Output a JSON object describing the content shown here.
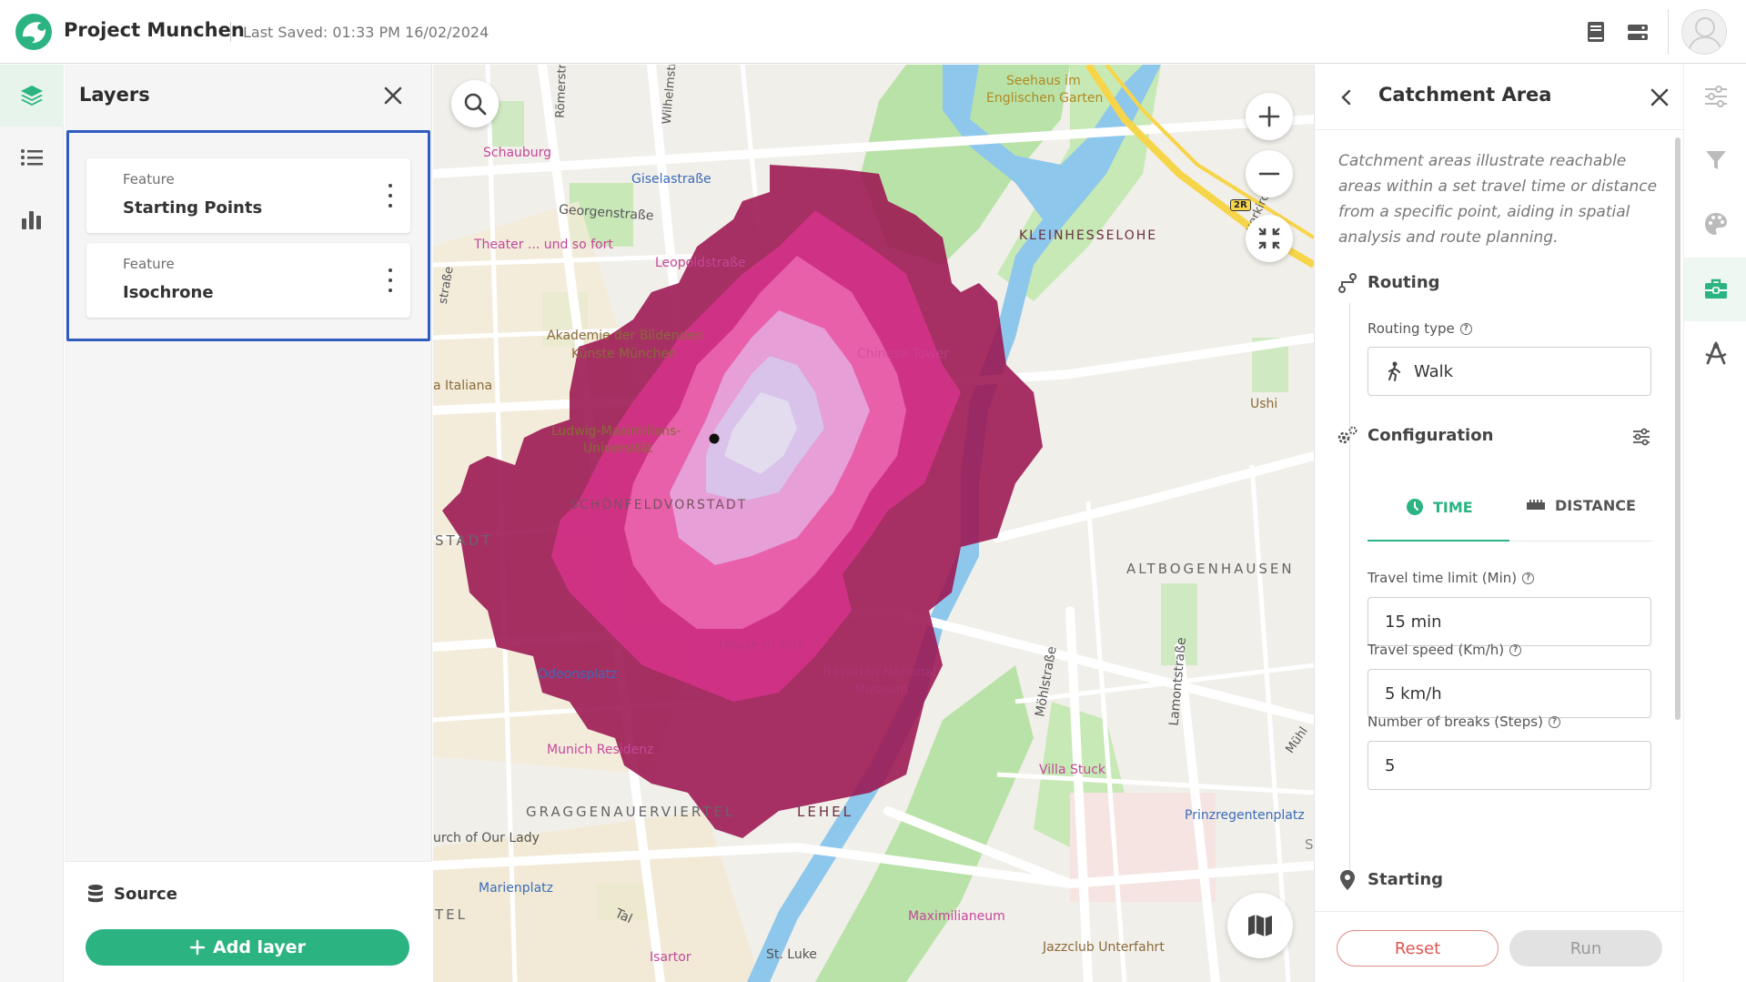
{
  "header": {
    "project_title": "Project Munchen",
    "last_saved": "Last Saved: 01:33 PM 16/02/2024"
  },
  "layers_panel": {
    "title": "Layers",
    "layers": [
      {
        "type_label": "Feature",
        "name": "Starting Points"
      },
      {
        "type_label": "Feature",
        "name": "Isochrone"
      }
    ],
    "source_label": "Source",
    "add_layer_label": "Add layer"
  },
  "map": {
    "labels": {
      "schauburg": "Schauburg",
      "giselastrasse": "Giselastraße",
      "georgenstrasse": "Georgenstraße",
      "leopoldstrasse": "Leopoldstraße",
      "theater": "Theater ... und so fort",
      "akademie1": "Akademie der Bildenden",
      "akademie2": "Künste München",
      "italiana": "a Italiana",
      "ludwig1": "Ludwig-Maximilians-",
      "ludwig2": "Universität",
      "schoenfeld": "SCHÖNFELDVORSTADT",
      "stadt": "STADT",
      "odeonsplatz": "Odeonsplatz",
      "residenz": "Munich Residenz",
      "graggenau": "GRAGGENAUERVIERTEL",
      "lehel": "LEHEL",
      "ourlady": "urch of Our Lady",
      "marienplatz": "Marienplatz",
      "tel": "TEL",
      "tal": "Tal",
      "isartor": "Isartor",
      "stluke": "St. Luke",
      "maximilianeum": "Maximilianeum",
      "jazzclub": "Jazzclub Unterfahrt",
      "villastuck": "Villa Stuck",
      "prinzregentenplatz": "Prinzregentenplatz",
      "altbogenhausen": "ALTBOGENHAUSEN",
      "ushi": "Ushi",
      "kleinhesselohe": "KLEINHESSELOHE",
      "seehaus1": "Seehaus im",
      "seehaus2": "Englischen Garten",
      "muehlstrasse": "Möhlstraße",
      "lamontstrasse": "Lamontstraße",
      "chinese_tower": "Chinese Tower",
      "house_of_arts": "House of Arts",
      "national1": "Bavarian National",
      "national2": "Museum",
      "roemer": "Römerstr.",
      "wilhelm": "Wilhelmstr.",
      "strasse_left": "straße",
      "road_badge": "2R",
      "uerkirch": "uerkirch.",
      "muehl": "Mühl",
      "s_edge": "S"
    }
  },
  "catchment_panel": {
    "title": "Catchment Area",
    "description": "Catchment areas illustrate reachable areas within a set travel time or distance from a specific point, aiding in spatial analysis and route planning.",
    "routing": {
      "section_title": "Routing",
      "type_label": "Routing type",
      "type_value": "Walk"
    },
    "configuration": {
      "section_title": "Configuration",
      "tabs": [
        "TIME",
        "DISTANCE"
      ],
      "active_tab": "TIME",
      "fields": [
        {
          "label": "Travel time limit (Min)",
          "value": "15 min"
        },
        {
          "label": "Travel speed (Km/h)",
          "value": "5 km/h"
        },
        {
          "label": "Number of breaks (Steps)",
          "value": "5"
        }
      ]
    },
    "starting": {
      "section_title": "Starting"
    },
    "reset_label": "Reset",
    "run_label": "Run"
  },
  "colors": {
    "accent": "#2bb381",
    "selection_border": "#2e5cbf",
    "iso_step_1": "#e6b8e6",
    "iso_step_5": "#9b1450"
  },
  "icons": {
    "left_rail": [
      "layers-icon",
      "legend-list-icon",
      "bar-chart-icon"
    ],
    "right_rail": [
      "properties-sliders-icon",
      "filter-icon",
      "palette-icon",
      "toolbox-icon",
      "scenario-tools-icon"
    ],
    "map_controls": [
      "search-icon",
      "zoom-in-icon",
      "zoom-out-icon",
      "fullscreen-exit-icon",
      "basemap-icon"
    ]
  }
}
